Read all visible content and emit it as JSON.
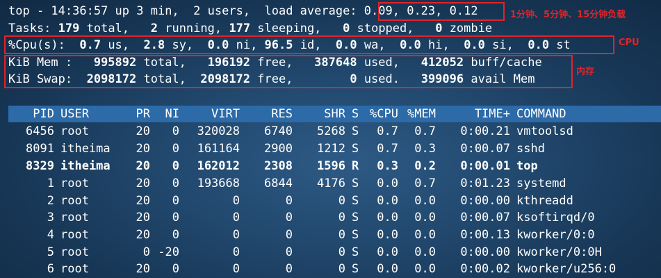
{
  "summary": {
    "top_prefix": "top - ",
    "time": "14:36:57",
    "uptime": " up 3 min,  ",
    "users_count": "2",
    "users_label": " users,  load average: ",
    "load_average": "0.09, 0.23, 0.12",
    "tasks_label": "Tasks: ",
    "tasks_total": "179",
    "tasks_total_label": " total,   ",
    "tasks_running": "2",
    "tasks_running_label": " running, ",
    "tasks_sleeping": "177",
    "tasks_sleeping_label": " sleeping,   ",
    "tasks_stopped": "0",
    "tasks_stopped_label": " stopped,   ",
    "tasks_zombie": "0",
    "tasks_zombie_label": " zombie",
    "cpu_label": "%Cpu(s):  ",
    "cpu_us": "0.7",
    "cpu_us_label": " us,  ",
    "cpu_sy": "2.8",
    "cpu_sy_label": " sy,  ",
    "cpu_ni": "0.0",
    "cpu_ni_label": " ni, ",
    "cpu_id": "96.5",
    "cpu_id_label": " id,  ",
    "cpu_wa": "0.0",
    "cpu_wa_label": " wa,  ",
    "cpu_hi": "0.0",
    "cpu_hi_label": " hi,  ",
    "cpu_si": "0.0",
    "cpu_si_label": " si,  ",
    "cpu_st": "0.0",
    "cpu_st_label": " st",
    "mem_label": "KiB Mem :   ",
    "mem_total": "995892",
    "mem_total_label": " total,   ",
    "mem_free": "196192",
    "mem_free_label": " free,   ",
    "mem_used": "387648",
    "mem_used_label": " used,   ",
    "mem_buff": "412052",
    "mem_buff_label": " buff/cache",
    "swap_label": "KiB Swap:  ",
    "swap_total": "2098172",
    "swap_total_label": " total,  ",
    "swap_free": "2098172",
    "swap_free_label": " free,        ",
    "swap_used": "0",
    "swap_used_label": " used.   ",
    "swap_avail": "399096",
    "swap_avail_label": " avail Mem"
  },
  "annotations": {
    "load": "1分钟、5分钟、15分钟负载",
    "cpu": "CPU",
    "mem": "内存"
  },
  "colors": {
    "annotation_red": "#e0242a",
    "header_bar": "#2c6aa8",
    "background": "#1d4266",
    "text": "#ffffff"
  },
  "table": {
    "headers": {
      "pid": "PID",
      "user": "USER",
      "pr": "PR",
      "ni": "NI",
      "virt": "VIRT",
      "res": "RES",
      "shr": "SHR",
      "s": "S",
      "cpu": "%CPU",
      "mem": "%MEM",
      "time": "TIME+",
      "command": "COMMAND"
    },
    "rows": [
      {
        "pid": "6456",
        "user": "root",
        "pr": "20",
        "ni": "0",
        "virt": "320028",
        "res": "6740",
        "shr": "5268",
        "s": "S",
        "cpu": "0.7",
        "mem": "0.7",
        "time": "0:00.21",
        "command": "vmtoolsd"
      },
      {
        "pid": "8091",
        "user": "itheima",
        "pr": "20",
        "ni": "0",
        "virt": "161164",
        "res": "2900",
        "shr": "1212",
        "s": "S",
        "cpu": "0.7",
        "mem": "0.3",
        "time": "0:00.07",
        "command": "sshd"
      },
      {
        "pid": "8329",
        "user": "itheima",
        "pr": "20",
        "ni": "0",
        "virt": "162012",
        "res": "2308",
        "shr": "1596",
        "s": "R",
        "cpu": "0.3",
        "mem": "0.2",
        "time": "0:00.01",
        "command": "top"
      },
      {
        "pid": "1",
        "user": "root",
        "pr": "20",
        "ni": "0",
        "virt": "193668",
        "res": "6844",
        "shr": "4176",
        "s": "S",
        "cpu": "0.0",
        "mem": "0.7",
        "time": "0:01.23",
        "command": "systemd"
      },
      {
        "pid": "2",
        "user": "root",
        "pr": "20",
        "ni": "0",
        "virt": "0",
        "res": "0",
        "shr": "0",
        "s": "S",
        "cpu": "0.0",
        "mem": "0.0",
        "time": "0:00.00",
        "command": "kthreadd"
      },
      {
        "pid": "3",
        "user": "root",
        "pr": "20",
        "ni": "0",
        "virt": "0",
        "res": "0",
        "shr": "0",
        "s": "S",
        "cpu": "0.0",
        "mem": "0.0",
        "time": "0:00.07",
        "command": "ksoftirqd/0"
      },
      {
        "pid": "4",
        "user": "root",
        "pr": "20",
        "ni": "0",
        "virt": "0",
        "res": "0",
        "shr": "0",
        "s": "S",
        "cpu": "0.0",
        "mem": "0.0",
        "time": "0:00.13",
        "command": "kworker/0:0"
      },
      {
        "pid": "5",
        "user": "root",
        "pr": "0",
        "ni": "-20",
        "virt": "0",
        "res": "0",
        "shr": "0",
        "s": "S",
        "cpu": "0.0",
        "mem": "0.0",
        "time": "0:00.00",
        "command": "kworker/0:0H"
      },
      {
        "pid": "6",
        "user": "root",
        "pr": "20",
        "ni": "0",
        "virt": "0",
        "res": "0",
        "shr": "0",
        "s": "S",
        "cpu": "0.0",
        "mem": "0.0",
        "time": "0:00.02",
        "command": "kworker/u256:0"
      }
    ]
  }
}
